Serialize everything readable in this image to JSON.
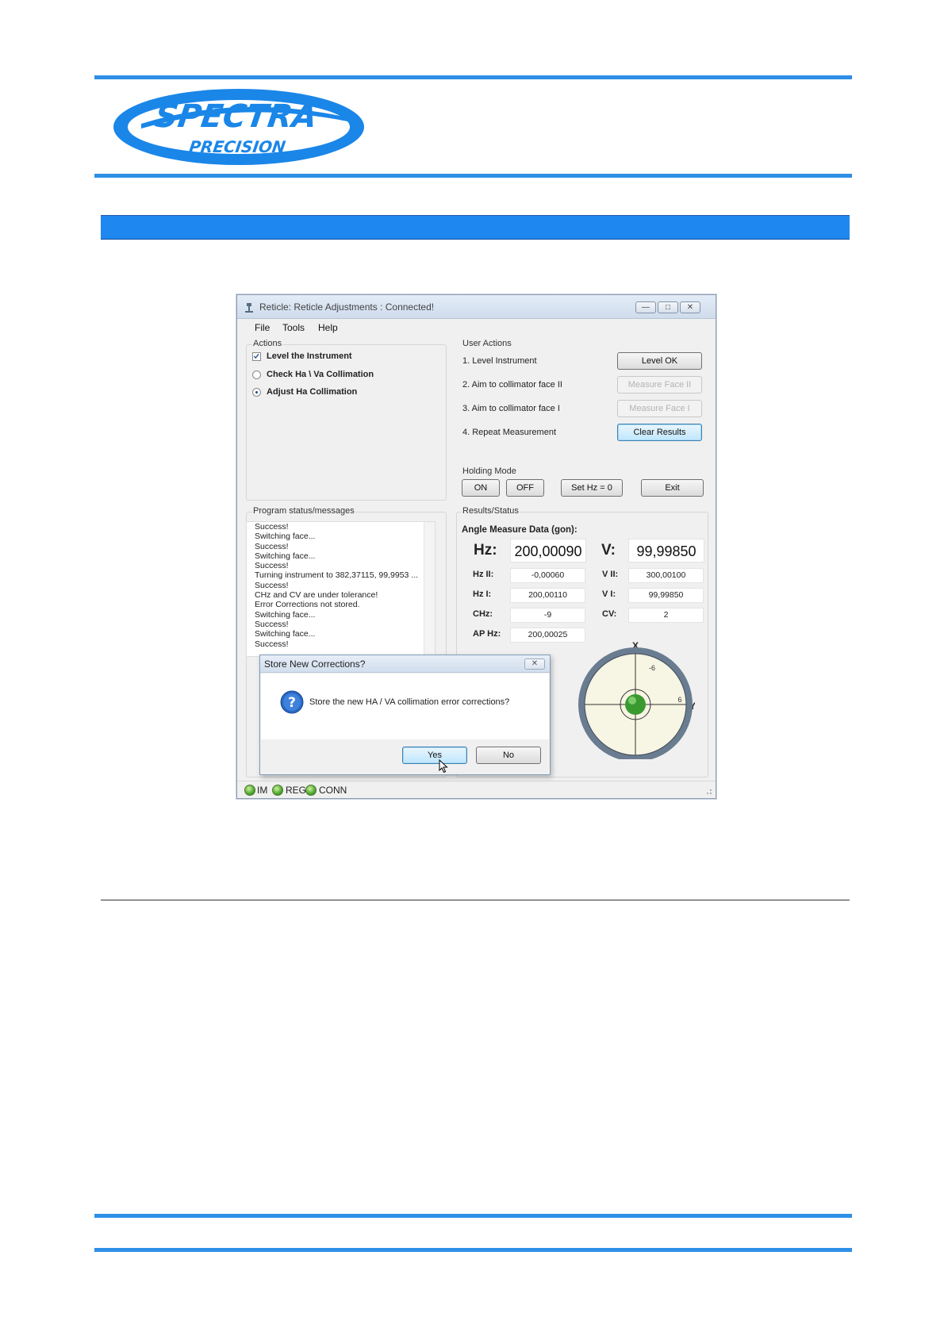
{
  "document": {
    "logo": {
      "line1": "SPECTRA",
      "line2": "PRECISION",
      "trademark": "®"
    }
  },
  "window": {
    "title": "Reticle: Reticle Adjustments : Connected!",
    "menu": [
      "File",
      "Tools",
      "Help"
    ],
    "actions": {
      "label": "Actions",
      "options": [
        {
          "label": "Level the Instrument",
          "control": "checkbox",
          "checked": true
        },
        {
          "label": "Check Ha \\ Va Collimation",
          "control": "radio",
          "checked": false
        },
        {
          "label": "Adjust Ha Collimation",
          "control": "radio",
          "checked": true
        }
      ]
    },
    "user_actions": {
      "label": "User Actions",
      "steps": [
        {
          "text": "1.  Level Instrument",
          "button": "Level OK",
          "enabled": true
        },
        {
          "text": "2.  Aim to collimator face II",
          "button": "Measure Face II",
          "enabled": false
        },
        {
          "text": "3.  Aim to collimator face I",
          "button": "Measure Face I",
          "enabled": false
        },
        {
          "text": "4.  Repeat Measurement",
          "button": "Clear Results",
          "enabled": true
        }
      ]
    },
    "holding_mode": {
      "label": "Holding Mode",
      "buttons": {
        "on": "ON",
        "off": "OFF",
        "set_hz": "Set Hz = 0",
        "exit": "Exit"
      }
    },
    "program_status": {
      "label": "Program status/messages",
      "lines": [
        "Success!",
        "Switching face...",
        "Success!",
        "Switching face...",
        "Success!",
        "Turning instrument to 382,37115, 99,9953 ...",
        "Success!",
        "CHz and CV are under tolerance!",
        "Error Corrections not stored.",
        "Switching face...",
        "Success!",
        "Switching face...",
        "Success!"
      ]
    },
    "results": {
      "label": "Results/Status",
      "heading": "Angle Measure Data (gon):",
      "hz_label": "Hz:",
      "hz_value": "200,00090",
      "v_label": "V:",
      "v_value": "99,99850",
      "hz2_label": "Hz II:",
      "hz2_value": "-0,00060",
      "v2_label": "V II:",
      "v2_value": "300,00100",
      "hz1_label": "Hz I:",
      "hz1_value": "200,00110",
      "v1_label": "V I:",
      "v1_value": "99,99850",
      "chz_label": "CHz:",
      "chz_value": "-9",
      "cv_label": "CV:",
      "cv_value": "2",
      "aphz_label": "AP Hz:",
      "aphz_value": "200,00025"
    },
    "bubble": {
      "x_label": "X",
      "y_label": "Y",
      "x_tick": "-6",
      "y_tick": "6"
    },
    "status_bar": {
      "items": [
        "IM",
        "REG",
        "CONN"
      ]
    }
  },
  "dialog": {
    "title": "Store New Corrections?",
    "message": "Store the new HA / VA collimation error corrections?",
    "yes": "Yes",
    "no": "No"
  }
}
